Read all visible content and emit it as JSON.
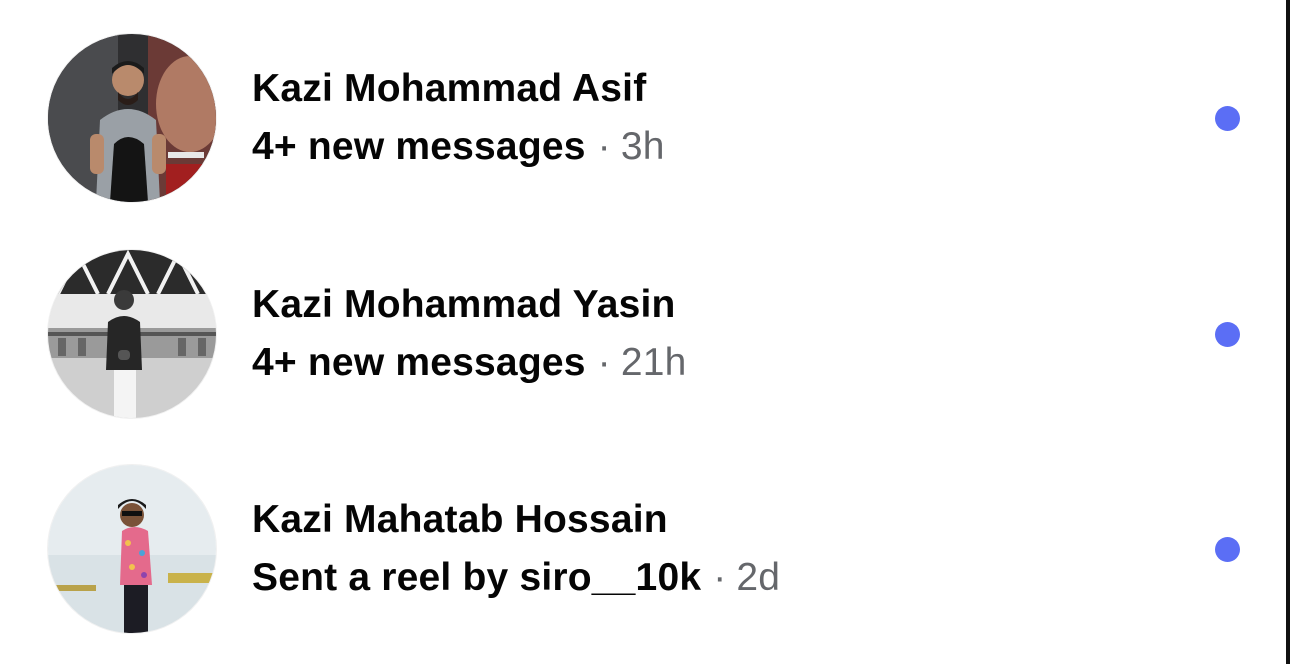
{
  "theme": {
    "unread_dot_color": "#5b6ef5",
    "secondary_text_color": "#65676b",
    "primary_text_color": "#050505"
  },
  "conversations": [
    {
      "name": "Kazi Mohammad Asif",
      "message": "4+ new messages",
      "separator": "·",
      "time": "3h",
      "unread": true,
      "avatar_icon": "profile-photo"
    },
    {
      "name": "Kazi Mohammad Yasin",
      "message": "4+ new messages",
      "separator": "·",
      "time": "21h",
      "unread": true,
      "avatar_icon": "profile-photo"
    },
    {
      "name": "Kazi Mahatab Hossain",
      "message": "Sent a reel by siro__10k",
      "separator": "·",
      "time": "2d",
      "unread": true,
      "avatar_icon": "profile-photo"
    }
  ]
}
